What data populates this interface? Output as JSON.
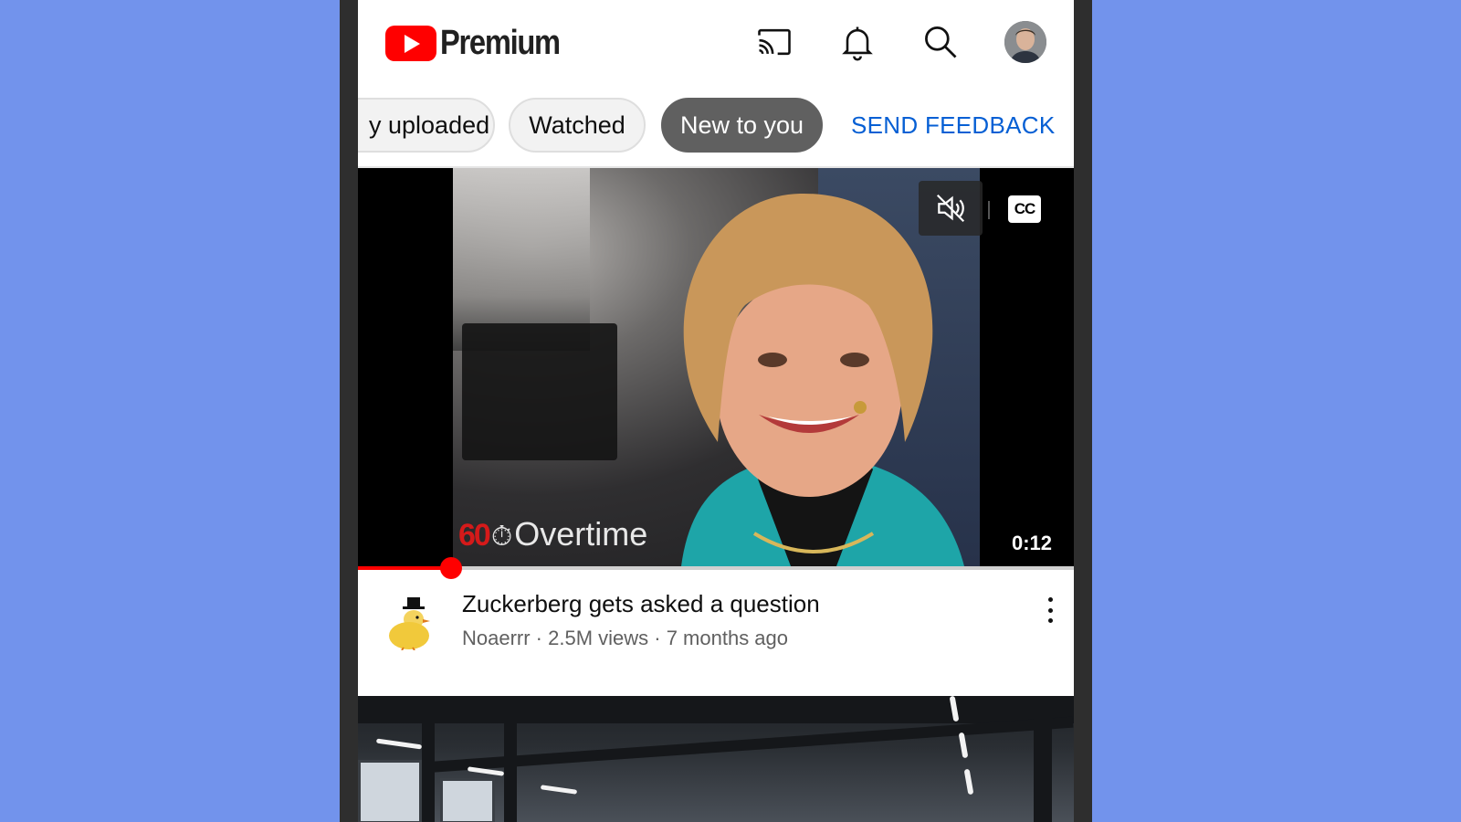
{
  "header": {
    "brand": "Premium",
    "icons": [
      "cast-icon",
      "bell-icon",
      "search-icon",
      "avatar"
    ]
  },
  "chips": {
    "items": [
      "y uploaded",
      "Watched",
      "New to you"
    ],
    "selected": "New to you",
    "send_feedback": "SEND FEEDBACK"
  },
  "video": {
    "overlay_brand_60": "60",
    "overlay_brand_text": "Overtime",
    "duration": "0:12",
    "cc_label": "CC",
    "progress_fraction": 0.13
  },
  "meta": {
    "title": "Zuckerberg gets asked a question",
    "subtitle": "Noaerrr · 2.5M views · 7 months ago"
  },
  "colors": {
    "background": "#7293ec",
    "youtube_red": "#ff0000",
    "link_blue": "#065fd4",
    "chip_selected": "#606060"
  }
}
